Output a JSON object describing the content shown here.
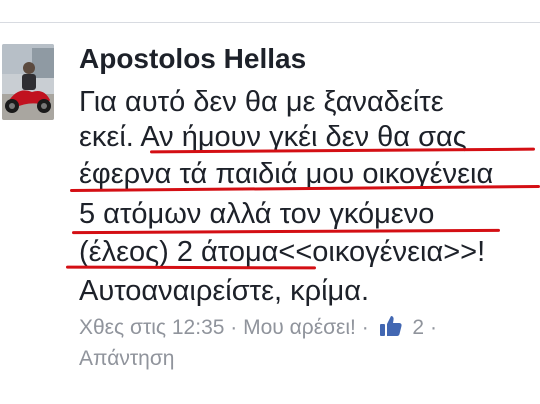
{
  "comment": {
    "author": "Apostolos Hellas",
    "lines": [
      "Για αυτό δεν θα με ξαναδείτε",
      "εκεί. Αν ήμουν γκέι δεν θα σας",
      "έφερνα τά παιδιά μου οικογένεια",
      "5 ατόμων αλλά τον γκόμενο",
      "(έλεος) 2 άτομα<<οικογένεια>>!",
      "Αυτοαναιρείστε, κρίμα."
    ],
    "timestamp": "Χθες στις 12:35",
    "separator": "·",
    "like_label": "Μου αρέσει!",
    "like_count": "2",
    "reply_label": "Απάντηση"
  },
  "colors": {
    "text": "#1d2129",
    "meta": "#90949c",
    "underline": "#d40f14",
    "like_icon": "#4267b2"
  }
}
